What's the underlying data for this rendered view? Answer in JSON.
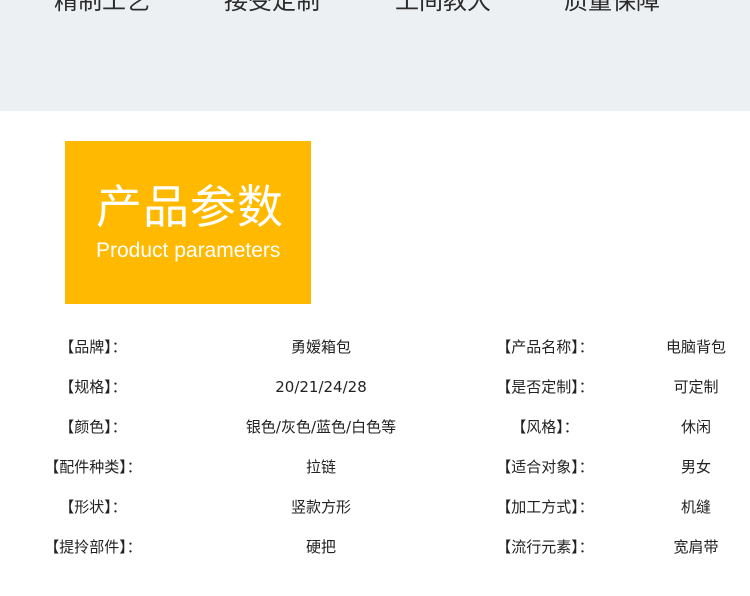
{
  "features": [
    "精制工艺",
    "接受定制",
    "工间教大",
    "质量保障"
  ],
  "header": {
    "title_zh": "产品参数",
    "title_en": "Product parameters",
    "accent_color": "#ffb900"
  },
  "params": [
    {
      "left_label": "【品牌】：",
      "left_value": "勇嫒箱包",
      "right_label": "【产品名称】：",
      "right_value": "电脑背包"
    },
    {
      "left_label": "【规格】：",
      "left_value": "20/21/24/28",
      "right_label": "【是否定制】：",
      "right_value": "可定制"
    },
    {
      "left_label": "【颜色】：",
      "left_value": "银色/灰色/蓝色/白色等",
      "right_label": "【风格】：",
      "right_value": "休闲"
    },
    {
      "left_label": "【配件种类】：",
      "left_value": "拉链",
      "right_label": "【适合对象】：",
      "right_value": "男女"
    },
    {
      "left_label": "【形状】：",
      "left_value": "竖款方形",
      "right_label": "【加工方式】：",
      "right_value": "机缝"
    },
    {
      "left_label": "【提拎部件】：",
      "left_value": "硬把",
      "right_label": "【流行元素】：",
      "right_value": "宽肩带"
    }
  ]
}
